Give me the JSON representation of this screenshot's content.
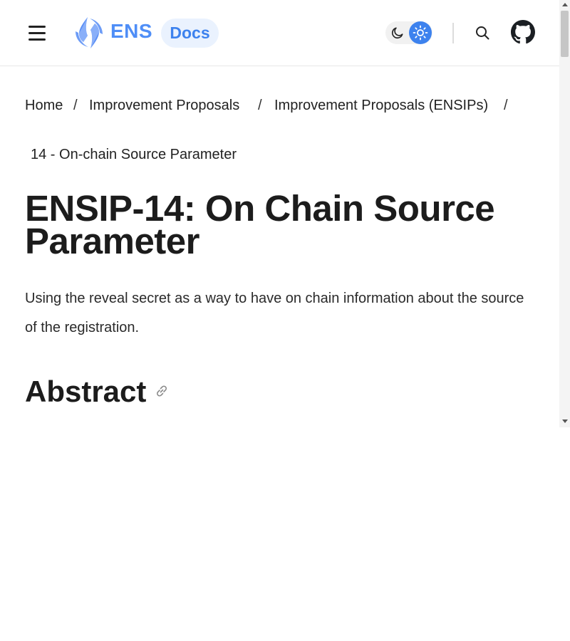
{
  "header": {
    "brand": "ENS",
    "docs_label": "Docs",
    "icons": {
      "menu": "hamburger-menu-icon",
      "logo": "ens-logo-icon",
      "moon": "moon-icon",
      "sun": "sun-icon",
      "search": "search-icon",
      "github": "github-icon"
    },
    "colors": {
      "brand": "#4f8ef7",
      "accent": "#3d82ee",
      "pill_bg": "#eaf2fe"
    }
  },
  "breadcrumb": {
    "items": [
      "Home",
      "Improvement Proposals",
      "Improvement Proposals (ENSIPs)",
      "14 - On-chain Source Parameter"
    ],
    "separator": "/"
  },
  "page": {
    "title": "ENSIP-14: On Chain Source Parameter",
    "description": "Using the reveal secret as a way to have on chain information about the source of the registration.",
    "section_heading": "Abstract",
    "anchor_icon": "link-icon"
  }
}
